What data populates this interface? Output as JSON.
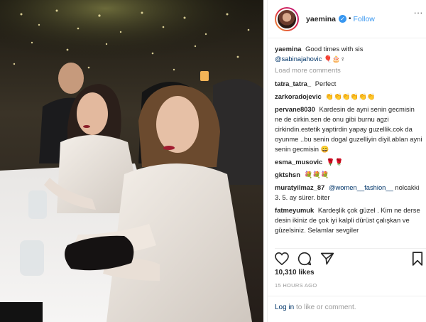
{
  "post": {
    "username": "yaemina",
    "follow_label": "Follow",
    "dot": "•",
    "caption_user": "yaemina",
    "caption_text": "Good times with sis",
    "caption_mention": "@sabinajahovic",
    "caption_emoji": "🎈🎂♀",
    "load_more": "Load more comments",
    "likes": "10,310 likes",
    "time": "15 HOURS AGO",
    "login_link": "Log in",
    "login_rest": "to like or comment.",
    "more": "..."
  },
  "comments": [
    {
      "user": "tatra_tatra_",
      "text": "Perfect"
    },
    {
      "user": "zarkoradojevic",
      "text": "👏👏👏👏👏👏"
    },
    {
      "user": "pervane8030",
      "text": "Kardesin de ayni senin gecmisin ne de cirkin.sen de onu gibi burnu agzi cirkindin.estetik yaptirdin yapay guzellik.cok da oyunme ..bu senin dogal guzelliyin diyil.ablan ayni senin gecmisin 😄"
    },
    {
      "user": "esma_musovic",
      "text": "🌹🌹"
    },
    {
      "user": "gktshsn",
      "text": "💐💐💐"
    },
    {
      "user": "muratyilmaz_87",
      "mention": "@women__fashion__",
      "text": "nolcakki 3. 5. ay sürer. biter"
    },
    {
      "user": "fatmeyumuk",
      "text": "Kardeşlik çok güzel . Kim ne derse desin ikiniz de çok iyi kalpli dürüst çalışkan ve güzelsiniz. Selamlar sevgiler"
    }
  ],
  "colors": {
    "link_blue": "#3897f0",
    "mention": "#003569",
    "muted": "#999999",
    "text": "#262626"
  },
  "icons": [
    "heart-icon",
    "comment-icon",
    "share-icon",
    "bookmark-icon",
    "verified-icon"
  ]
}
